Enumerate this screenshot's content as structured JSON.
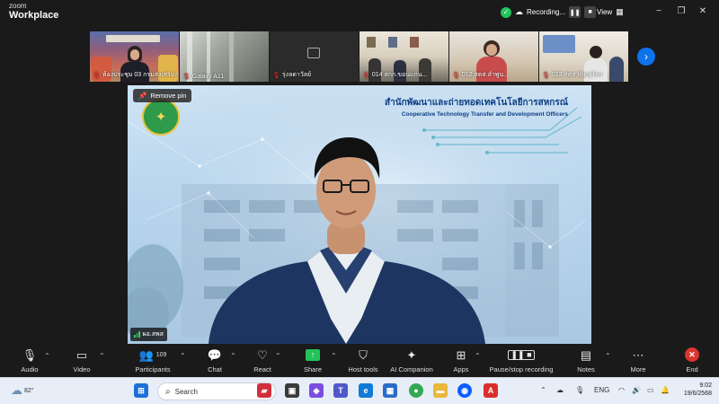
{
  "app": {
    "brand_top": "zoom",
    "brand_bottom": "Workplace"
  },
  "titlebar": {
    "recording_label": "Recording...",
    "view_label": "View",
    "controls": {
      "minimize": "−",
      "restore": "❐",
      "close": "✕"
    }
  },
  "thumbnails": [
    {
      "name": "ห้องประชุม 03 กรมส่งเสริมสห..."
    },
    {
      "name": "Galaxy A11"
    },
    {
      "name": "รุ่งลดาวัลย์"
    },
    {
      "name": "014 สกก.ขอนแก่น..."
    },
    {
      "name": "012 สตส.ลำพูน..."
    },
    {
      "name": "012 สตส.พิษณุโลก"
    }
  ],
  "main_video": {
    "pin_label": "Remove pin",
    "org_title_th": "สำนักพัฒนาและถ่ายทอดเทคโนโลยีการสหกรณ์",
    "org_title_en": "Cooperative Technology Transfer and Development Officers",
    "speaker_name": "ผอ.สพส"
  },
  "toolbar": {
    "audio": "Audio",
    "video": "Video",
    "participants": "Participants",
    "participants_count": "109",
    "chat": "Chat",
    "react": "React",
    "share": "Share",
    "host_tools": "Host tools",
    "ai_companion": "AI Companion",
    "apps": "Apps",
    "pause_recording": "Pause/stop recording",
    "notes": "Notes",
    "more": "More",
    "end": "End"
  },
  "taskbar": {
    "temperature": "82°",
    "search_placeholder": "Search",
    "language": "ENG",
    "time": "9:02",
    "date": "19/6/2568"
  },
  "colors": {
    "zoom_blue": "#0e72ed",
    "recording_green": "#23c35a",
    "end_red": "#d9352f",
    "muted_red": "#e63b3b",
    "title_navy": "#0d3e86"
  }
}
